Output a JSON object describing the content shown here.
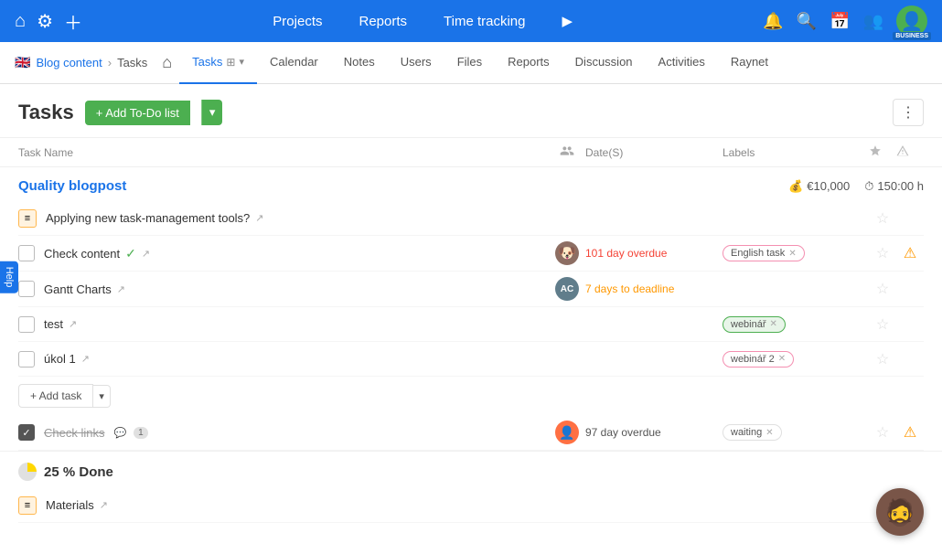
{
  "topNav": {
    "links": [
      "Projects",
      "Reports",
      "Time tracking"
    ],
    "playLabel": "▶"
  },
  "breadcrumb": {
    "flag": "🇬🇧",
    "parent": "Blog content",
    "child": "Tasks"
  },
  "subNavTabs": [
    {
      "label": "Tasks",
      "active": true
    },
    {
      "label": "Calendar",
      "active": false
    },
    {
      "label": "Notes",
      "active": false
    },
    {
      "label": "Users",
      "active": false
    },
    {
      "label": "Files",
      "active": false
    },
    {
      "label": "Reports",
      "active": false
    },
    {
      "label": "Discussion",
      "active": false
    },
    {
      "label": "Activities",
      "active": false
    },
    {
      "label": "Raynet",
      "active": false
    }
  ],
  "tasksTitle": "Tasks",
  "addTodoLabel": "+ Add To-Do list",
  "colHeaders": {
    "taskName": "Task Name",
    "dates": "Date(S)",
    "labels": "Labels"
  },
  "section1": {
    "title": "Quality blogpost",
    "budget": "€10,000",
    "hours": "150:00 h",
    "tasks": [
      {
        "id": "t0",
        "type": "icon",
        "name": "Applying new task-management tools?",
        "hasCheckbox": false,
        "strikethrough": false,
        "externalLink": true,
        "assignee": null,
        "date": "",
        "dateClass": "",
        "labels": []
      },
      {
        "id": "t1",
        "type": "checkbox",
        "name": "Check content",
        "hasCheckbox": true,
        "checked": false,
        "greenCheck": true,
        "strikethrough": false,
        "externalLink": true,
        "assignee": {
          "type": "img",
          "color": "#8d6e63",
          "label": "🐶"
        },
        "date": "101 day overdue",
        "dateClass": "date-overdue",
        "labels": [
          {
            "text": "English task",
            "style": "pink-border"
          }
        ],
        "hasAlert": true
      },
      {
        "id": "t2",
        "type": "checkbox",
        "name": "Gantt Charts",
        "hasCheckbox": true,
        "checked": false,
        "greenCheck": false,
        "strikethrough": false,
        "externalLink": true,
        "assignee": {
          "type": "initials",
          "color": "#607d8b",
          "label": "AC"
        },
        "date": "7 days to deadline",
        "dateClass": "date-warning",
        "labels": []
      },
      {
        "id": "t3",
        "type": "checkbox",
        "name": "test",
        "hasCheckbox": true,
        "checked": false,
        "greenCheck": false,
        "strikethrough": false,
        "externalLink": true,
        "assignee": null,
        "date": "",
        "dateClass": "",
        "labels": [
          {
            "text": "webinář",
            "style": "green-bg"
          }
        ]
      },
      {
        "id": "t4",
        "type": "checkbox",
        "name": "úkol 1",
        "hasCheckbox": true,
        "checked": false,
        "greenCheck": false,
        "strikethrough": false,
        "externalLink": true,
        "assignee": null,
        "date": "",
        "dateClass": "",
        "labels": [
          {
            "text": "webinář 2",
            "style": "pink-border"
          }
        ]
      }
    ]
  },
  "addTaskLabel": "+ Add task",
  "completedTask": {
    "id": "tc1",
    "name": "Check links",
    "checked": true,
    "strikethrough": true,
    "commentCount": "1",
    "assignee": {
      "type": "img2",
      "color": "#ff7043",
      "label": "👤"
    },
    "date": "97 day overdue",
    "dateClass": "date-normal",
    "labels": [
      {
        "text": "waiting",
        "style": ""
      }
    ],
    "hasAlert": true
  },
  "section2": {
    "progress": "25 % Done",
    "subTitle": "Materials"
  },
  "helpLabel": "Help",
  "businessBadge": "BUSINESS"
}
